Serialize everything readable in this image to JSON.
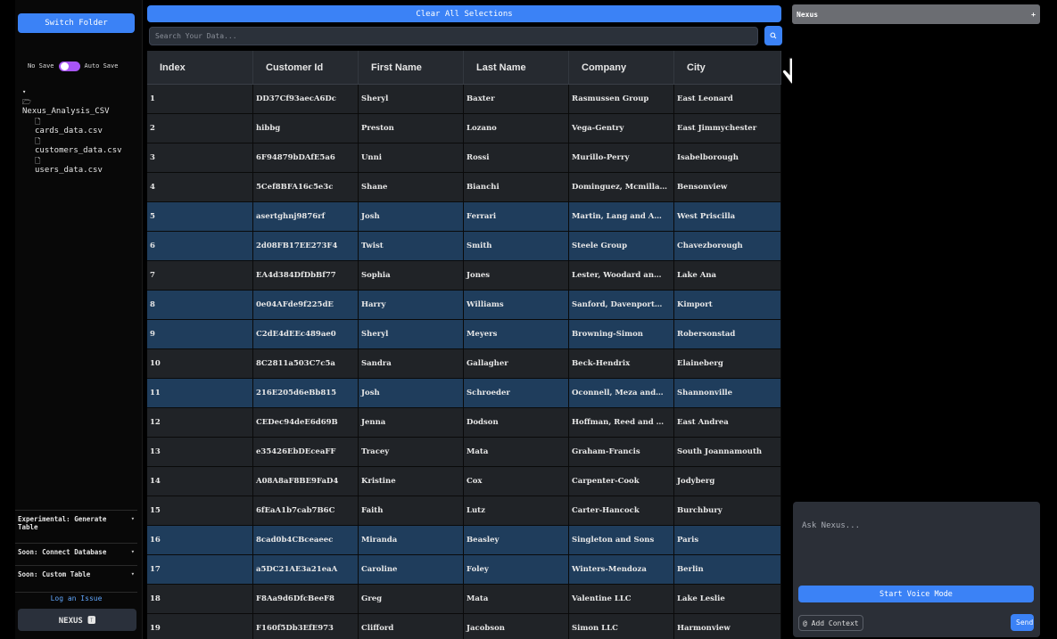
{
  "sidebar": {
    "switch_folder_label": "Switch Folder",
    "no_save_label": "No Save",
    "auto_save_label": "Auto Save",
    "folder_name": "Nexus_Analysis_CSV",
    "files": [
      "cards_data.csv",
      "customers_data.csv",
      "users_data.csv"
    ],
    "options": [
      {
        "label": "Experimental: Generate Table"
      },
      {
        "label": "Soon: Connect Database"
      },
      {
        "label": "Soon: Custom Table"
      }
    ],
    "log_issue_label": "Log an Issue",
    "nexus_button_label": "NEXUS 🆃"
  },
  "main": {
    "clear_selections_label": "Clear All Selections",
    "search_placeholder": "Search Your Data...",
    "columns": [
      "Index",
      "Customer Id",
      "First Name",
      "Last Name",
      "Company",
      "City"
    ],
    "rows": [
      {
        "selected": false,
        "cells": [
          "1",
          "DD37Cf93aecA6Dc",
          "Sheryl",
          "Baxter",
          "Rasmussen Group",
          "East Leonard"
        ]
      },
      {
        "selected": false,
        "cells": [
          "2",
          "hibbg",
          "Preston",
          "Lozano",
          "Vega-Gentry",
          "East Jimmychester"
        ]
      },
      {
        "selected": false,
        "cells": [
          "3",
          "6F94879bDAfE5a6",
          "Unni",
          "Rossi",
          "Murillo-Perry",
          "Isabelborough"
        ]
      },
      {
        "selected": false,
        "cells": [
          "4",
          "5Cef8BFA16c5e3c",
          "Shane",
          "Bianchi",
          "Dominguez, Mcmilla…",
          "Bensonview"
        ]
      },
      {
        "selected": true,
        "cells": [
          "5",
          "asertghnj9876rf",
          "Josh",
          "Ferrari",
          "Martin, Lang and A…",
          "West Priscilla"
        ]
      },
      {
        "selected": true,
        "cells": [
          "6",
          "2d08FB17EE273F4",
          "Twist",
          "Smith",
          "Steele Group",
          "Chavezborough"
        ]
      },
      {
        "selected": false,
        "cells": [
          "7",
          "EA4d384DfDbBf77",
          "Sophia",
          "Jones",
          "Lester, Woodard an…",
          "Lake Ana"
        ]
      },
      {
        "selected": true,
        "cells": [
          "8",
          "0e04AFde9f225dE",
          "Harry",
          "Williams",
          "Sanford, Davenport…",
          "Kimport"
        ]
      },
      {
        "selected": true,
        "cells": [
          "9",
          "C2dE4dEEc489ae0",
          "Sheryl",
          "Meyers",
          "Browning-Simon",
          "Robersonstad"
        ]
      },
      {
        "selected": false,
        "cells": [
          "10",
          "8C2811a503C7c5a",
          "Sandra",
          "Gallagher",
          "Beck-Hendrix",
          "Elaineberg"
        ]
      },
      {
        "selected": true,
        "cells": [
          "11",
          "216E205d6eBb815",
          "Josh",
          "Schroeder",
          "Oconnell, Meza and…",
          "Shannonville"
        ]
      },
      {
        "selected": false,
        "cells": [
          "12",
          "CEDec94deE6d69B",
          "Jenna",
          "Dodson",
          "Hoffman, Reed and …",
          "East Andrea"
        ]
      },
      {
        "selected": false,
        "cells": [
          "13",
          "e35426EbDEceaFF",
          "Tracey",
          "Mata",
          "Graham-Francis",
          "South Joannamouth"
        ]
      },
      {
        "selected": false,
        "cells": [
          "14",
          "A08A8aF8BE9FaD4",
          "Kristine",
          "Cox",
          "Carpenter-Cook",
          "Jodyberg"
        ]
      },
      {
        "selected": false,
        "cells": [
          "15",
          "6fEaA1b7cab7B6C",
          "Faith",
          "Lutz",
          "Carter-Hancock",
          "Burchbury"
        ]
      },
      {
        "selected": true,
        "cells": [
          "16",
          "8cad0b4CBceaeec",
          "Miranda",
          "Beasley",
          "Singleton and Sons",
          "Paris"
        ]
      },
      {
        "selected": true,
        "cells": [
          "17",
          "a5DC21AE3a21eaA",
          "Caroline",
          "Foley",
          "Winters-Mendoza",
          "Berlin"
        ]
      },
      {
        "selected": false,
        "cells": [
          "18",
          "F8Aa9d6DfcBeeF8",
          "Greg",
          "Mata",
          "Valentine LLC",
          "Lake Leslie"
        ]
      },
      {
        "selected": false,
        "cells": [
          "19",
          "F160f5Db3EfE973",
          "Clifford",
          "Jacobson",
          "Simon LLC",
          "Harmonview"
        ]
      }
    ]
  },
  "nexus_panel": {
    "title": "Nexus",
    "plus_label": "+",
    "ask_placeholder": "Ask Nexus...",
    "voice_mode_label": "Start Voice Mode",
    "add_context_label": "@ Add Context",
    "send_label": "Send"
  },
  "colors": {
    "accent": "#3b82f6",
    "toggle": "#a855f7",
    "selected_row": "#1f3d5c"
  }
}
